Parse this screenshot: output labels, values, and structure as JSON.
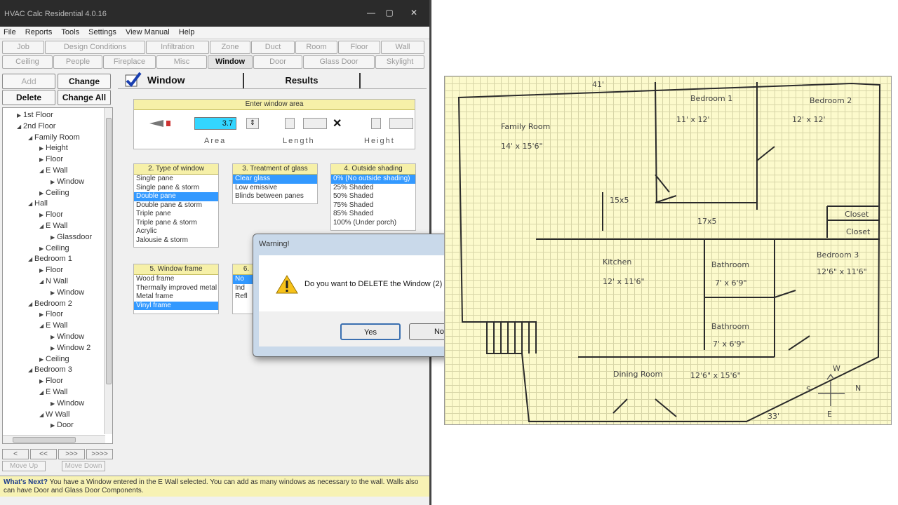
{
  "window": {
    "title": "HVAC Calc Residential 4.0.16",
    "minimize": "—",
    "maximize": "▢",
    "close": "✕"
  },
  "menu": [
    "File",
    "Reports",
    "Tools",
    "Settings",
    "View Manual",
    "Help"
  ],
  "tabs_row1": [
    "Job",
    "Design Conditions",
    "Infiltration",
    "Zone",
    "Duct",
    "Room",
    "Floor",
    "Wall"
  ],
  "tabs_row2": [
    "Ceiling",
    "People",
    "Fireplace",
    "Misc",
    "Window",
    "Door",
    "Glass Door",
    "Skylight"
  ],
  "actions": {
    "add": "Add",
    "change": "Change",
    "delete": "Delete",
    "change_all": "Change All"
  },
  "tree": [
    {
      "label": "1st Floor",
      "depth": 1,
      "arrow": "▶"
    },
    {
      "label": "2nd Floor",
      "depth": 1,
      "arrow": "◢"
    },
    {
      "label": "Family Room",
      "depth": 2,
      "arrow": "◢"
    },
    {
      "label": "Height",
      "depth": 3,
      "arrow": "▶"
    },
    {
      "label": "Floor",
      "depth": 3,
      "arrow": "▶"
    },
    {
      "label": "E Wall",
      "depth": 3,
      "arrow": "◢"
    },
    {
      "label": "Window",
      "depth": 4,
      "arrow": "▶"
    },
    {
      "label": "Ceiling",
      "depth": 3,
      "arrow": "▶"
    },
    {
      "label": "Hall",
      "depth": 2,
      "arrow": "◢"
    },
    {
      "label": "Floor",
      "depth": 3,
      "arrow": "▶"
    },
    {
      "label": "E Wall",
      "depth": 3,
      "arrow": "◢"
    },
    {
      "label": "Glassdoor",
      "depth": 4,
      "arrow": "▶"
    },
    {
      "label": "Ceiling",
      "depth": 3,
      "arrow": "▶"
    },
    {
      "label": "Bedroom 1",
      "depth": 2,
      "arrow": "◢"
    },
    {
      "label": "Floor",
      "depth": 3,
      "arrow": "▶"
    },
    {
      "label": "N Wall",
      "depth": 3,
      "arrow": "◢"
    },
    {
      "label": "Window",
      "depth": 4,
      "arrow": "▶"
    },
    {
      "label": "Bedroom 2",
      "depth": 2,
      "arrow": "◢"
    },
    {
      "label": "Floor",
      "depth": 3,
      "arrow": "▶"
    },
    {
      "label": "E Wall",
      "depth": 3,
      "arrow": "◢"
    },
    {
      "label": "Window",
      "depth": 4,
      "arrow": "▶"
    },
    {
      "label": "Window 2",
      "depth": 4,
      "arrow": "▶"
    },
    {
      "label": "Ceiling",
      "depth": 3,
      "arrow": "▶"
    },
    {
      "label": "Bedroom 3",
      "depth": 2,
      "arrow": "◢"
    },
    {
      "label": "Floor",
      "depth": 3,
      "arrow": "▶"
    },
    {
      "label": "E Wall",
      "depth": 3,
      "arrow": "◢"
    },
    {
      "label": "Window",
      "depth": 4,
      "arrow": "▶"
    },
    {
      "label": "W Wall",
      "depth": 3,
      "arrow": "◢"
    },
    {
      "label": "Door",
      "depth": 4,
      "arrow": "▶"
    }
  ],
  "nav": {
    "first": "<",
    "prev": "<<",
    "next": ">>>",
    "last": ">>>>",
    "move_up": "Move Up",
    "move_down": "Move Down"
  },
  "panel": {
    "title": "Window",
    "results": "Results",
    "entry_header": "Enter window area",
    "area_value": "3.7",
    "area_label": "Area",
    "length_label": "Length",
    "height_label": "Height"
  },
  "groups": [
    {
      "header": "2. Type of window",
      "items": [
        "Single pane",
        "Single pane & storm",
        "Double pane",
        "Double pane & storm",
        "Triple pane",
        "Triple pane & storm",
        "Acrylic",
        "Jalousie & storm"
      ],
      "selected": 2
    },
    {
      "header": "3. Treatment of glass",
      "items": [
        "Clear glass",
        "Low emissive",
        "Blinds between panes"
      ],
      "selected": 0
    },
    {
      "header": "4. Outside shading",
      "items": [
        "0%   (No outside shading)",
        "25%   Shaded",
        "50%   Shaded",
        "75%   Shaded",
        "85%   Shaded",
        "100% (Under porch)"
      ],
      "selected": 0
    },
    {
      "header": "5. Window frame",
      "items": [
        "Wood frame",
        "Thermally improved metal",
        "Metal frame",
        "Vinyl frame"
      ],
      "selected": 3
    },
    {
      "header": "6.",
      "items": [
        "No",
        "Ind",
        "Refl"
      ],
      "selected": 0
    }
  ],
  "status": {
    "lead": "What's Next?",
    "text": "You have a Window entered in the E Wall selected. You can add as many windows as necessary to the wall. Walls also can have Door and Glass Door Components."
  },
  "dialog": {
    "title": "Warning!",
    "message": "Do you want to DELETE the Window (2)",
    "yes": "Yes",
    "no": "No",
    "close": "✕"
  },
  "plan": {
    "labels": [
      {
        "text": "Family Room",
        "kind": "room"
      },
      {
        "text": "14' x 15'6\"",
        "kind": "dim"
      },
      {
        "text": "Bedroom 1",
        "kind": "room"
      },
      {
        "text": "11' x 12'",
        "kind": "dim"
      },
      {
        "text": "Bedroom 2",
        "kind": "room"
      },
      {
        "text": "12' x 12'",
        "kind": "dim"
      },
      {
        "text": "Kitchen",
        "kind": "room"
      },
      {
        "text": "12' x 11'6\"",
        "kind": "dim"
      },
      {
        "text": "Bathroom",
        "kind": "room"
      },
      {
        "text": "7' x 6'9\"",
        "kind": "dim"
      },
      {
        "text": "Bathroom",
        "kind": "room"
      },
      {
        "text": "7' x 6'9\"",
        "kind": "dim"
      },
      {
        "text": "Bedroom 3",
        "kind": "room"
      },
      {
        "text": "12'6\" x 11'6\"",
        "kind": "dim"
      },
      {
        "text": "Dining Room",
        "kind": "room"
      },
      {
        "text": "12'6\" x 15'6\"",
        "kind": "dim"
      },
      {
        "text": "Closet",
        "kind": "room"
      },
      {
        "text": "Closet",
        "kind": "room"
      },
      {
        "text": "17x5",
        "kind": "dim"
      },
      {
        "text": "15x5",
        "kind": "dim"
      },
      {
        "text": "41'",
        "kind": "dim"
      },
      {
        "text": "33'",
        "kind": "dim"
      },
      {
        "text": "N",
        "kind": "compass"
      },
      {
        "text": "S",
        "kind": "compass"
      },
      {
        "text": "E",
        "kind": "compass"
      },
      {
        "text": "W",
        "kind": "compass"
      }
    ]
  }
}
